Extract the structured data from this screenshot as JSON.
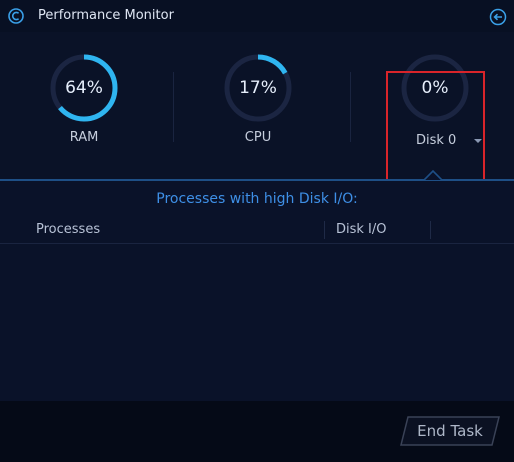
{
  "window": {
    "title": "Performance Monitor"
  },
  "gauges": [
    {
      "label": "RAM",
      "value_text": "64%",
      "value": 0.64
    },
    {
      "label": "CPU",
      "value_text": "17%",
      "value": 0.17
    },
    {
      "label": "Disk 0",
      "value_text": "0%",
      "value": 0.0
    }
  ],
  "panel": {
    "heading": "Processes with high Disk I/O:",
    "columns": [
      "Processes",
      "Disk I/O"
    ]
  },
  "footer": {
    "end_task_label": "End Task"
  },
  "colors": {
    "accent": "#2fb5f0",
    "track": "#1b2542",
    "highlight": "#d9242a",
    "heading": "#3e8fe6"
  },
  "icons": {
    "app": "app-logo-icon",
    "back": "back-arrow-icon",
    "dropdown": "chevron-down-icon"
  }
}
